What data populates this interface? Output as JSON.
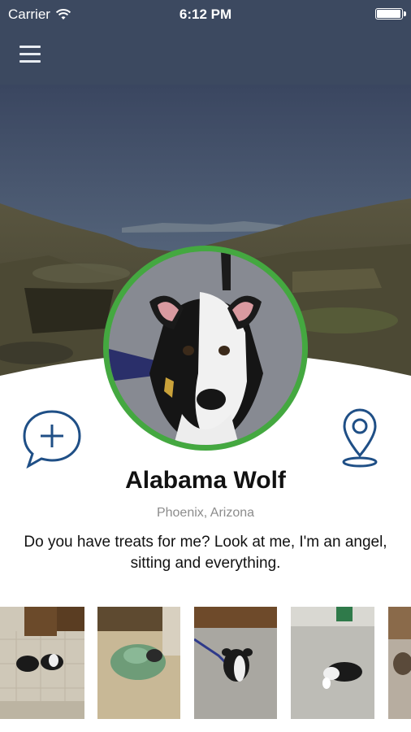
{
  "status_bar": {
    "carrier": "Carrier",
    "time": "6:12 PM",
    "battery_level": 1.0
  },
  "nav": {
    "menu_icon": "hamburger-menu-icon"
  },
  "profile": {
    "name": "Alabama Wolf",
    "location": "Phoenix, Arizona",
    "bio": "Do you have treats for me? Look at me, I'm an angel, sitting and everything.",
    "left_action_icon": "add-comment-icon",
    "right_action_icon": "location-pin-icon"
  },
  "colors": {
    "nav_bar": "#3c4960",
    "avatar_ring": "#44a840",
    "accent_icons": "#1f4f86"
  },
  "gallery": {
    "photo_count": 5
  }
}
